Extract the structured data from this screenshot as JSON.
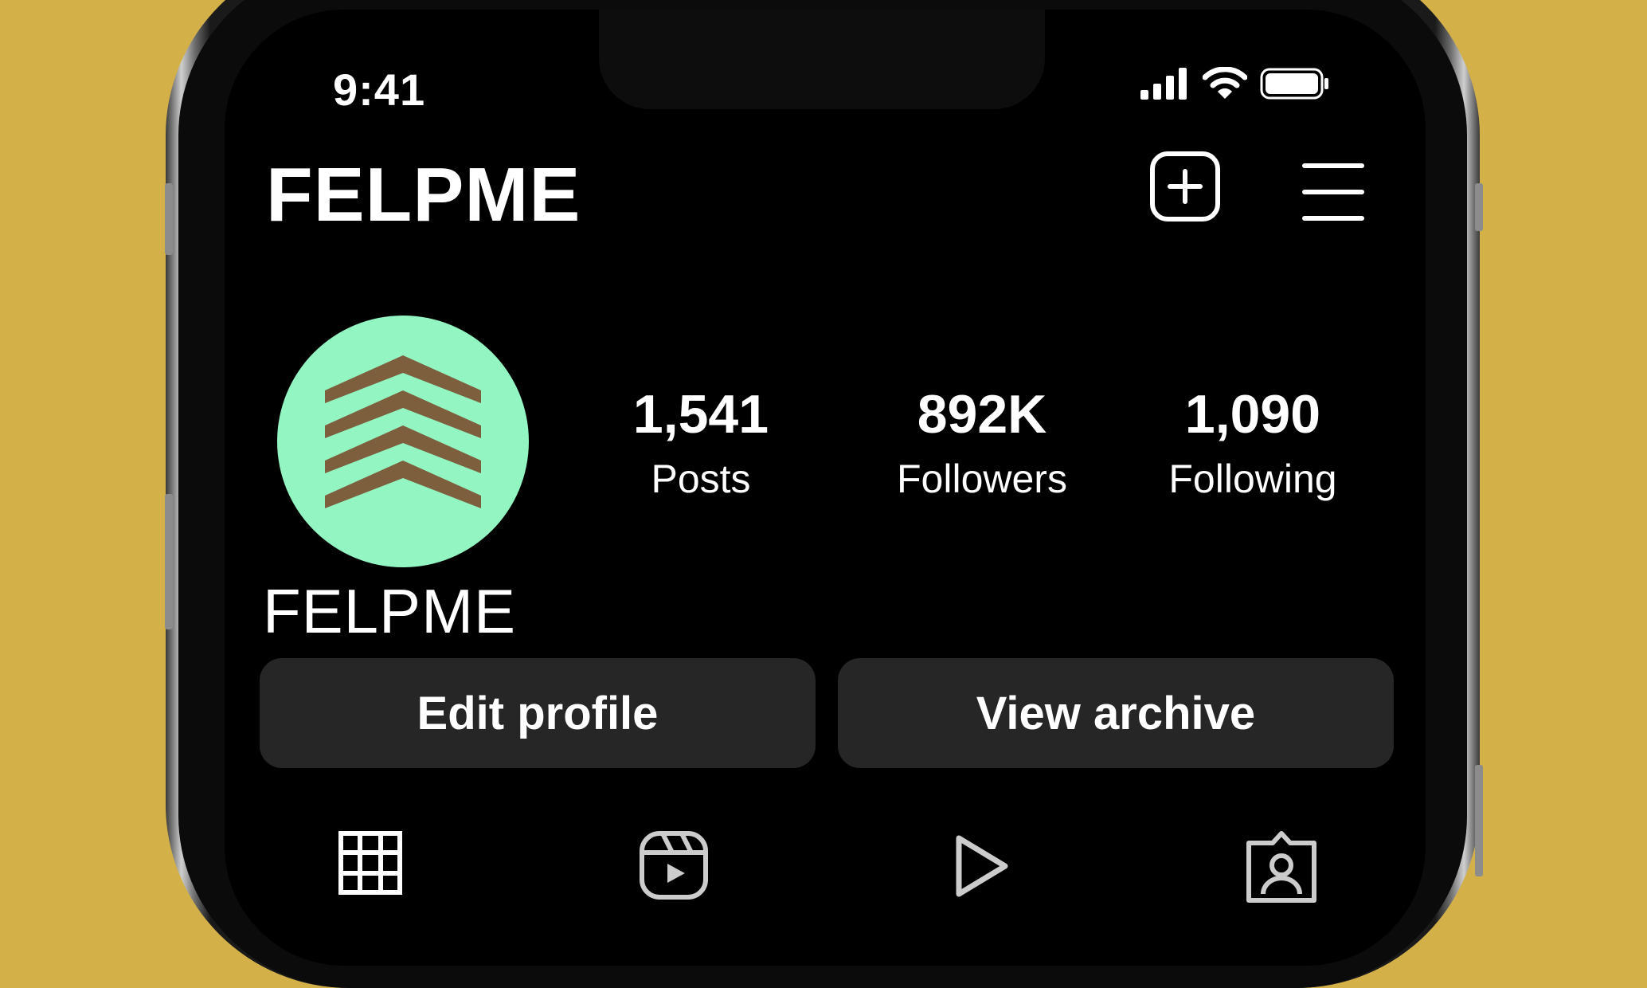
{
  "status_bar": {
    "time": "9:41",
    "icons": [
      "cellular-signal-icon",
      "wifi-icon",
      "battery-icon"
    ]
  },
  "header": {
    "title": "FELPME",
    "icons": [
      "add-post-icon",
      "menu-icon"
    ]
  },
  "profile": {
    "avatar_icon": "chevrons-up-logo",
    "display_name": "FELPME",
    "stats": [
      {
        "value": "1,541",
        "label": "Posts"
      },
      {
        "value": "892K",
        "label": "Followers"
      },
      {
        "value": "1,090",
        "label": "Following"
      }
    ]
  },
  "actions": {
    "edit_label": "Edit profile",
    "archive_label": "View archive"
  },
  "tabs": [
    {
      "icon": "grid-icon"
    },
    {
      "icon": "reels-icon"
    },
    {
      "icon": "video-icon"
    },
    {
      "icon": "tagged-icon"
    }
  ],
  "colors": {
    "background": "#d4b048",
    "screen": "#000000",
    "button": "#262626",
    "avatar_bg": "#93f5c2",
    "avatar_chevron": "#7d5e3d"
  }
}
